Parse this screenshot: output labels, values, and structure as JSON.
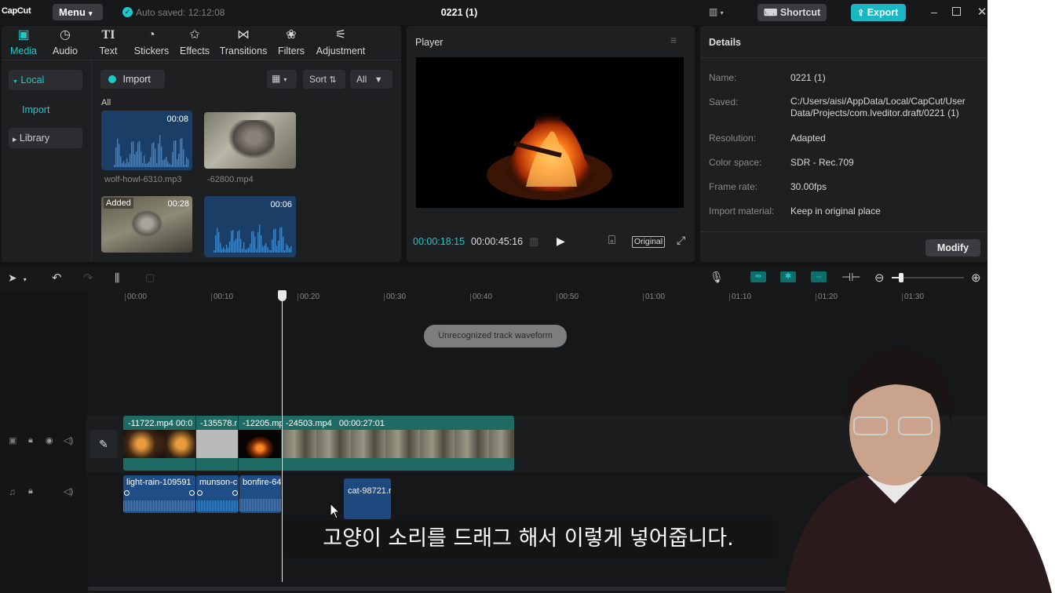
{
  "titlebar": {
    "logo": "CapCut",
    "menu": "Menu",
    "autosave": "Auto saved: 12:12:08",
    "title": "0221 (1)",
    "shortcut": "Shortcut",
    "export": "Export"
  },
  "tabs": [
    {
      "label": "Media",
      "icon": "media-icon"
    },
    {
      "label": "Audio",
      "icon": "audio-icon"
    },
    {
      "label": "Text",
      "icon": "text-icon"
    },
    {
      "label": "Stickers",
      "icon": "stickers-icon"
    },
    {
      "label": "Effects",
      "icon": "effects-icon"
    },
    {
      "label": "Transitions",
      "icon": "transitions-icon"
    },
    {
      "label": "Filters",
      "icon": "filters-icon"
    },
    {
      "label": "Adjustment",
      "icon": "adjustment-icon"
    }
  ],
  "sidebar": {
    "local": "Local",
    "import": "Import",
    "library": "Library"
  },
  "media": {
    "import": "Import",
    "sort": "Sort",
    "all": "All",
    "section": "All",
    "items": [
      {
        "name": "wolf-howl-6310.mp3",
        "duration": "00:08"
      },
      {
        "name": "-62800.mp4",
        "duration": ""
      },
      {
        "name": "",
        "duration": "00:28",
        "badge": "Added"
      },
      {
        "name": "",
        "duration": "00:06"
      }
    ]
  },
  "player": {
    "title": "Player",
    "current": "00:00:18:15",
    "total": "00:00:45:16",
    "original": "Original"
  },
  "details": {
    "title": "Details",
    "fields": [
      {
        "label": "Name:",
        "value": "0221 (1)"
      },
      {
        "label": "Saved:",
        "value": "C:/Users/aisi/AppData/Local/CapCut/User Data/Projects/com.lveditor.draft/0221 (1)"
      },
      {
        "label": "Resolution:",
        "value": "Adapted"
      },
      {
        "label": "Color space:",
        "value": "SDR - Rec.709"
      },
      {
        "label": "Frame rate:",
        "value": "30.00fps"
      },
      {
        "label": "Import material:",
        "value": "Keep in original place"
      }
    ],
    "modify": "Modify"
  },
  "ruler": [
    "00:00",
    "00:10",
    "00:20",
    "00:30",
    "00:40",
    "00:50",
    "01:00",
    "01:10",
    "01:20",
    "01:30"
  ],
  "toast": "Unrecognized track waveform",
  "video_clips": [
    {
      "label": "-11722.mp4   00:0"
    },
    {
      "label": "-135578.r"
    },
    {
      "label": "-12205.mp"
    },
    {
      "label": "-24503.mp4   00:00:27:01"
    }
  ],
  "audio_clips": [
    {
      "label": "light-rain-109591"
    },
    {
      "label": "munson-c"
    },
    {
      "label": "bonfire-64"
    },
    {
      "label": "cat-98721.r"
    }
  ],
  "subtitle": "고양이 소리를 드래그 해서 이렇게 넣어줍니다.",
  "colors": {
    "accent": "#1fc8c8",
    "export": "#19b6c4",
    "video_track": "#1f6b63",
    "audio_track": "#1f4d86"
  }
}
